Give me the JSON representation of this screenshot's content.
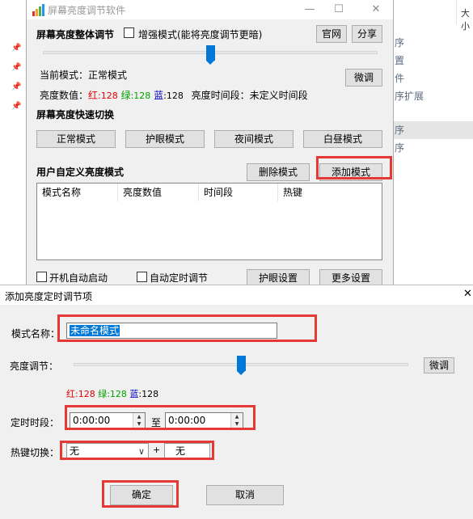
{
  "background": {
    "right_header": "大小",
    "items": [
      "序",
      "置",
      "件",
      "序扩展",
      "序",
      "序"
    ]
  },
  "app": {
    "title": "屏幕亮度调节软件",
    "section_overall": "屏幕亮度整体调节",
    "enhance_label": "增强模式(能将亮度调节更暗)",
    "btn_official": "官网",
    "btn_share": "分享",
    "current_mode_label": "当前模式：",
    "current_mode_value": "正常模式",
    "btn_fine_tune": "微调",
    "brightness_label": "亮度数值：",
    "red_label": "红",
    "red_value": ":128",
    "green_label": "绿",
    "green_value": ":128",
    "blue_label": "蓝",
    "blue_value": ":128",
    "period_label": "亮度时间段：",
    "period_value": "未定义时间段",
    "section_quick": "屏幕亮度快速切换",
    "btn_normal": "正常模式",
    "btn_eye": "护眼模式",
    "btn_night": "夜间模式",
    "btn_day": "白昼模式",
    "section_custom": "用户自定义亮度模式",
    "btn_delete": "删除模式",
    "btn_add": "添加模式",
    "columns": [
      "模式名称",
      "亮度数值",
      "时间段",
      "热键"
    ],
    "autostart_label": "开机自动启动",
    "autotimer_label": "自动定时调节",
    "btn_eye_settings": "护眼设置",
    "btn_more_settings": "更多设置",
    "slider_value": 0.5
  },
  "dialog": {
    "title": "添加亮度定时调节项",
    "name_label": "模式名称：",
    "name_value": "未命名模式",
    "brightness_label": "亮度调节：",
    "btn_fine_tune": "微调",
    "red_label": "红",
    "red_value": ":128",
    "green_label": "绿",
    "green_value": ":128",
    "blue_label": "蓝",
    "blue_value": ":128",
    "timer_label": "定时时段：",
    "time_start": "0:00:00",
    "to_label": "至",
    "time_end": "0:00:00",
    "hotkey_label": "热键切换：",
    "hotkey_mod": "无",
    "plus": "+",
    "hotkey_key": "无",
    "btn_ok": "确定",
    "btn_cancel": "取消",
    "slider_value": 0.5
  },
  "colors": {
    "red": "#e00000",
    "green": "#00a000",
    "blue": "#0000c0",
    "highlight": "#e53935",
    "accent": "#0078d7"
  }
}
